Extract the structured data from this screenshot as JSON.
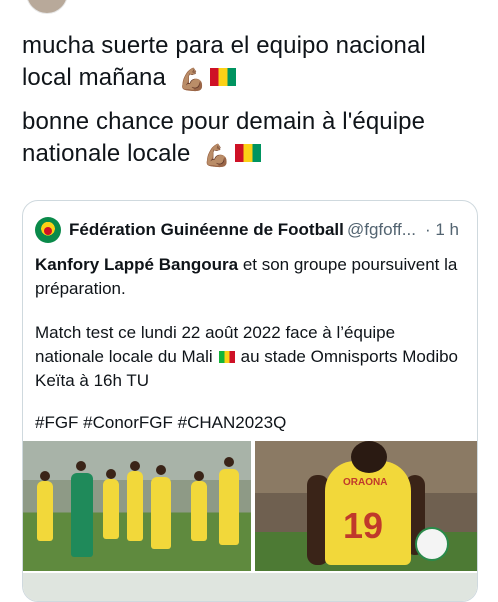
{
  "tweet": {
    "line1": "mucha suerte para el equipo nacional local mañana",
    "line2": "bonne chance pour demain à l'équipe nationale locale",
    "emoji_icon": "flexed-biceps-icon",
    "flag_icon": "guinea-flag-icon"
  },
  "quote": {
    "display_name": "Fédération Guinéenne de Football",
    "handle": "@fgfoff...",
    "time": "· 1 h",
    "para1_bold": "Kanfory Lappé Bangoura",
    "para1_rest": " et son groupe poursuivent la préparation.",
    "para2_a": "Match test ce lundi 22 août 2022 face à l’équipe nationale locale du Mali",
    "para2_b": "au stade Omnisports Modibo Keïta à 16h TU",
    "hashtags": "#FGF #ConorFGF #CHAN2023Q",
    "mali_flag_icon": "mali-flag-icon",
    "jersey_name": "ORAONA",
    "jersey_number": "19"
  },
  "colors": {
    "text": "#0f1419",
    "secondary": "#536471",
    "border": "#cfd9de"
  }
}
